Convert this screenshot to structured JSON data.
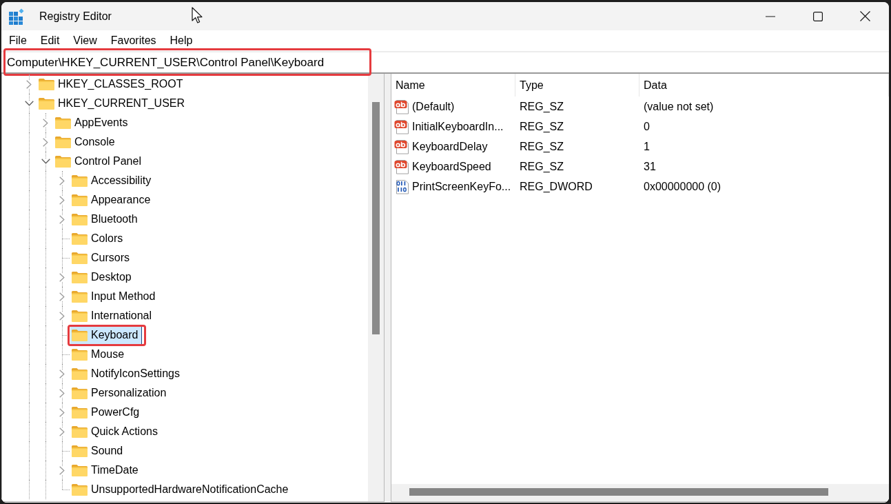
{
  "window": {
    "title": "Registry Editor"
  },
  "menu": [
    "File",
    "Edit",
    "View",
    "Favorites",
    "Help"
  ],
  "address_bar": {
    "path": "Computer\\HKEY_CURRENT_USER\\Control Panel\\Keyboard",
    "highlighted": true
  },
  "tree": [
    {
      "label": "HKEY_CLASSES_ROOT",
      "has_children": true,
      "expanded": false,
      "selected": false,
      "highlighted": false
    },
    {
      "label": "HKEY_CURRENT_USER",
      "has_children": true,
      "expanded": true,
      "selected": false,
      "highlighted": false,
      "children": [
        {
          "label": "AppEvents",
          "has_children": true,
          "expanded": false,
          "selected": false,
          "highlighted": false
        },
        {
          "label": "Console",
          "has_children": true,
          "expanded": false,
          "selected": false,
          "highlighted": false
        },
        {
          "label": "Control Panel",
          "has_children": true,
          "expanded": true,
          "selected": false,
          "highlighted": false,
          "children": [
            {
              "label": "Accessibility",
              "has_children": true,
              "expanded": false,
              "selected": false,
              "highlighted": false
            },
            {
              "label": "Appearance",
              "has_children": true,
              "expanded": false,
              "selected": false,
              "highlighted": false
            },
            {
              "label": "Bluetooth",
              "has_children": true,
              "expanded": false,
              "selected": false,
              "highlighted": false
            },
            {
              "label": "Colors",
              "has_children": false,
              "selected": false,
              "highlighted": false
            },
            {
              "label": "Cursors",
              "has_children": false,
              "selected": false,
              "highlighted": false
            },
            {
              "label": "Desktop",
              "has_children": true,
              "expanded": false,
              "selected": false,
              "highlighted": false
            },
            {
              "label": "Input Method",
              "has_children": true,
              "expanded": false,
              "selected": false,
              "highlighted": false
            },
            {
              "label": "International",
              "has_children": true,
              "expanded": false,
              "selected": false,
              "highlighted": false
            },
            {
              "label": "Keyboard",
              "has_children": false,
              "selected": true,
              "highlighted": true
            },
            {
              "label": "Mouse",
              "has_children": false,
              "selected": false,
              "highlighted": false
            },
            {
              "label": "NotifyIconSettings",
              "has_children": true,
              "expanded": false,
              "selected": false,
              "highlighted": false
            },
            {
              "label": "Personalization",
              "has_children": true,
              "expanded": false,
              "selected": false,
              "highlighted": false
            },
            {
              "label": "PowerCfg",
              "has_children": true,
              "expanded": false,
              "selected": false,
              "highlighted": false
            },
            {
              "label": "Quick Actions",
              "has_children": true,
              "expanded": false,
              "selected": false,
              "highlighted": false
            },
            {
              "label": "Sound",
              "has_children": false,
              "selected": false,
              "highlighted": false
            },
            {
              "label": "TimeDate",
              "has_children": true,
              "expanded": false,
              "selected": false,
              "highlighted": false
            },
            {
              "label": "UnsupportedHardwareNotificationCache",
              "has_children": false,
              "selected": false,
              "highlighted": false
            }
          ]
        }
      ]
    }
  ],
  "values_list": {
    "columns": [
      "Name",
      "Type",
      "Data"
    ],
    "rows": [
      {
        "kind": "string",
        "name": "(Default)",
        "type": "REG_SZ",
        "data": "(value not set)"
      },
      {
        "kind": "string",
        "name": "InitialKeyboardIn...",
        "type": "REG_SZ",
        "data": "0"
      },
      {
        "kind": "string",
        "name": "KeyboardDelay",
        "type": "REG_SZ",
        "data": "1"
      },
      {
        "kind": "string",
        "name": "KeyboardSpeed",
        "type": "REG_SZ",
        "data": "31"
      },
      {
        "kind": "binary",
        "name": "PrintScreenKeyFo...",
        "type": "REG_DWORD",
        "data": "0x00000000 (0)"
      }
    ]
  }
}
